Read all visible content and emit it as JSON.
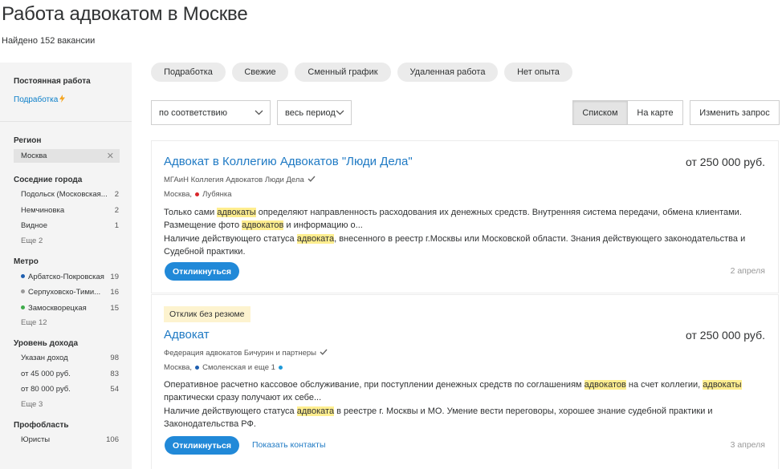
{
  "page": {
    "title": "Работа адвокатом в Москве",
    "found": "Найдено 152 вакансии"
  },
  "sidebar": {
    "employment": {
      "header": "Постоянная работа",
      "link": "Подработка",
      "link_icon": "lightning-icon"
    },
    "region": {
      "header": "Регион",
      "selected": "Москва",
      "clear_icon": "close-icon"
    },
    "nearby": {
      "header": "Соседние города",
      "items": [
        {
          "label": "Подольск (Московская...",
          "count": "2"
        },
        {
          "label": "Немчиновка",
          "count": "2"
        },
        {
          "label": "Видное",
          "count": "1"
        }
      ],
      "more": "Еще 2"
    },
    "metro": {
      "header": "Метро",
      "items": [
        {
          "label": "Арбатско-Покровская",
          "count": "19",
          "color": "#1f5fb0"
        },
        {
          "label": "Серпуховско-Тими...",
          "count": "16",
          "color": "#9a9a9a"
        },
        {
          "label": "Замоскворецкая",
          "count": "15",
          "color": "#3eab4a"
        }
      ],
      "more": "Еще 12"
    },
    "income": {
      "header": "Уровень дохода",
      "items": [
        {
          "label": "Указан доход",
          "count": "98"
        },
        {
          "label": "от 45 000 руб.",
          "count": "83"
        },
        {
          "label": "от 80 000 руб.",
          "count": "54"
        }
      ],
      "more": "Еще 3"
    },
    "profarea": {
      "header": "Профобласть",
      "items": [
        {
          "label": "Юристы",
          "count": "106"
        }
      ]
    }
  },
  "chips": [
    "Подработка",
    "Свежие",
    "Сменный график",
    "Удаленная работа",
    "Нет опыта"
  ],
  "controls": {
    "sort": "по соответствию",
    "period": "весь период",
    "view_list": "Списком",
    "view_map": "На карте",
    "change_query": "Изменить запрос"
  },
  "vacancies": [
    {
      "title": "Адвокат в Коллегию Адвокатов \"Люди Дела\"",
      "salary": "от 250 000 руб.",
      "company": "МГАиН Коллегия Адвокатов Люди Дела",
      "metro": "Москва,",
      "station": "Лубянка",
      "station_color": "#d9262b",
      "desc1_a": "Только сами ",
      "desc1_h1": "адвокаты",
      "desc1_b": " определяют направленность расходования их денежных средств. Внутренняя система передачи, обмена клиентами.",
      "desc1_c": "Размещение фото ",
      "desc1_h2": "адвокатов",
      "desc1_d": " и информацию о...",
      "desc2_a": "Наличие действующего статуса ",
      "desc2_h": "адвоката",
      "desc2_b": ", внесенного в реестр г.Москвы или Московской области. Знания действующего законодательства и",
      "desc2_c": "Судебной практики.",
      "respond": "Откликнуться",
      "date": "2 апреля"
    },
    {
      "badge": "Отклик без резюме",
      "title": "Адвокат",
      "salary": "от 250 000 руб.",
      "company": "Федерация адвокатов Бичурин и партнеры",
      "metro": "Москва,",
      "station": "Смоленская и еще 1",
      "station_color": "#1f9ad8",
      "desc1_a": "Оперативное расчетно кассовое обслуживание, при поступлении денежных средств по соглашениям ",
      "desc1_h1": "адвокатов",
      "desc1_b": " на счет коллегии, ",
      "desc1_h2": "адвокаты",
      "desc1_c": "практически сразу получают их себе...",
      "desc2_a": "Наличие действующего статуса ",
      "desc2_h": "адвоката",
      "desc2_b": " в реестре г. Москвы и МО. Умение вести переговоры, хорошее знание судебной практики и",
      "desc2_c": "Законодательства РФ.",
      "respond": "Откликнуться",
      "contacts": "Показать контакты",
      "date": "3 апреля"
    }
  ]
}
